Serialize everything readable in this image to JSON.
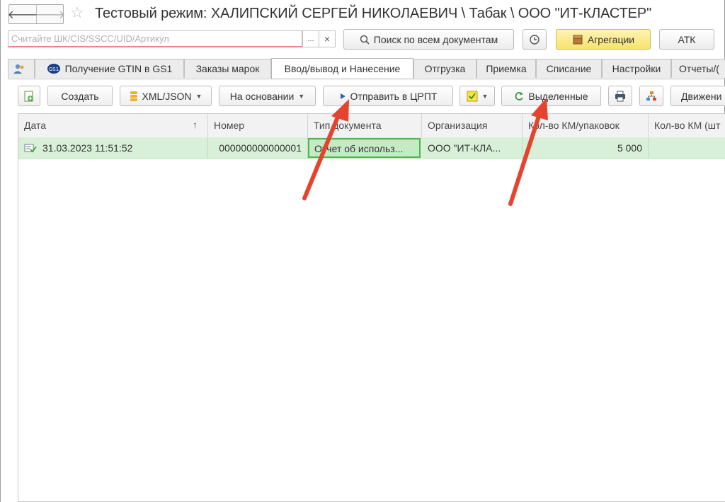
{
  "window": {
    "title": "Тестовый режим:  ХАЛИПСКИЙ СЕРГЕЙ НИКОЛАЕВИЧ \\ Табак \\ ООО \"ИТ-КЛАСТЕР\"",
    "back_glyph": "🡐",
    "forward_glyph": "🡒",
    "star_glyph": "☆"
  },
  "search": {
    "placeholder": "Считайте ШК/CIS/SSCC/UID/Артикул",
    "value": "",
    "select_button": "...",
    "clear_button": "×",
    "search_all_label": "Поиск по всем документам",
    "aggregation_label": "Агрегации",
    "atk_label": "АТК"
  },
  "tabs": [
    {
      "label": ""
    },
    {
      "label": "Получение GTIN в GS1"
    },
    {
      "label": "Заказы марок"
    },
    {
      "label": "Ввод/вывод и Нанесение",
      "active": true
    },
    {
      "label": "Отгрузка"
    },
    {
      "label": "Приемка"
    },
    {
      "label": "Списание"
    },
    {
      "label": "Настройки"
    },
    {
      "label": "Отчеты/("
    }
  ],
  "toolbar": {
    "create_label": "Создать",
    "xml_label": "XML/JSON",
    "based_on_label": "На основании",
    "send_label": "Отправить в ЦРПТ",
    "selected_label": "Выделенные",
    "movement_label": "Движени"
  },
  "table": {
    "columns": [
      "Дата",
      "Номер",
      "Тип документа",
      "Организация",
      "Кол-во КМ/упаковок",
      "Кол-во КМ (шт"
    ],
    "sort_glyph": "↑",
    "rows": [
      {
        "date": "31.03.2023 11:51:52",
        "number": "000000000000001",
        "type": "Отчет об использ...",
        "org": "ООО \"ИТ-КЛА...",
        "km_packs": "5 000",
        "km_pcs": ""
      }
    ]
  },
  "colors": {
    "accent_red": "#e5432f",
    "row_green": "#d8f0d8",
    "yellow_button": "#f6e36e"
  }
}
